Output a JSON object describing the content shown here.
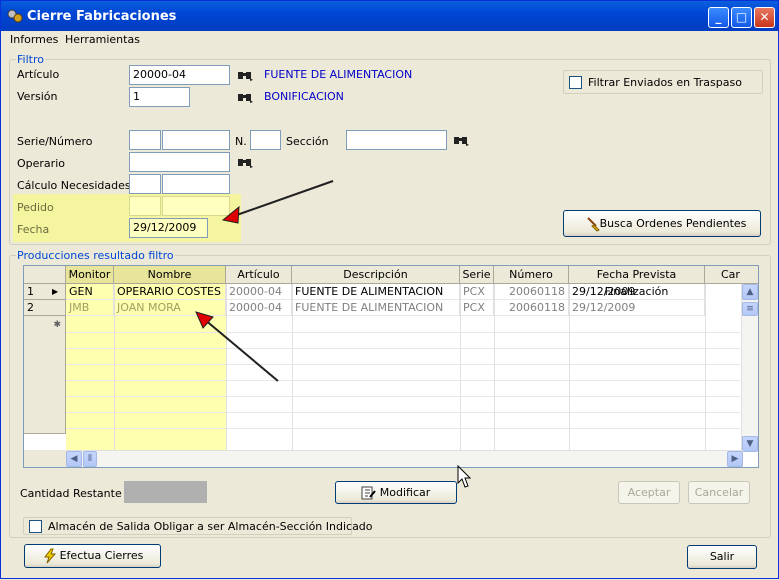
{
  "window": {
    "title": "Cierre Fabricaciones",
    "minimize": "_",
    "maximize": "□",
    "close": "✕"
  },
  "menu": {
    "items": [
      "Informes",
      "Herramientas"
    ]
  },
  "filtro": {
    "legend": "Filtro",
    "articulo_label": "Artículo",
    "articulo_value": "20000-04",
    "articulo_desc": "FUENTE DE ALIMENTACION",
    "version_label": "Versión",
    "version_value": "1",
    "version_desc": "BONIFICACION",
    "filtrar_label": "Filtrar Enviados en Traspaso",
    "serie_label": "Serie/Número",
    "n_label": "N.",
    "seccion_label": "Sección",
    "operario_label": "Operario",
    "calculo_label": "Cálculo Necesidades",
    "pedido_label": "Pedido",
    "fecha_label": "Fecha",
    "fecha_value": "29/12/2009",
    "busca_button": "Busca Ordenes Pendientes"
  },
  "producciones": {
    "legend": "Producciones resultado filtro",
    "columns": [
      "Monitor",
      "Nombre",
      "Artículo",
      "Descripción",
      "Serie",
      "Número",
      "Fecha Prevista Finalización",
      "Car"
    ],
    "rows": [
      {
        "num": "1",
        "monitor": "GEN",
        "nombre": "OPERARIO COSTES",
        "articulo": "20000-04",
        "descripcion": "FUENTE DE ALIMENTACION",
        "serie": "PCX",
        "numero": "20060118",
        "fecha": "29/12/2009"
      },
      {
        "num": "2",
        "monitor": "JMB",
        "nombre": "JOAN MORA",
        "articulo": "20000-04",
        "descripcion": "FUENTE DE ALIMENTACION",
        "serie": "PCX",
        "numero": "20060118",
        "fecha": "29/12/2009"
      }
    ],
    "new_row_marker": "✱"
  },
  "bottom": {
    "cantidad_label": "Cantidad Restante :",
    "modificar_button": "Modificar",
    "aceptar_button": "Aceptar",
    "cancelar_button": "Cancelar",
    "almacen_label": "Almacén de Salida Obligar a ser Almacén-Sección Indicado",
    "efectua_button": "Efectua Cierres",
    "salir_button": "Salir"
  }
}
